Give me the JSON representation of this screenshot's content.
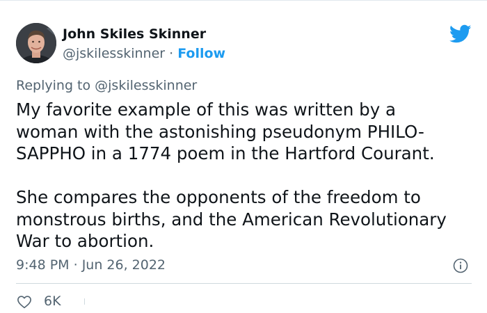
{
  "author": {
    "name": "John Skiles Skinner",
    "handle": "@jskilesskinner",
    "separator": " · ",
    "follow_label": "Follow"
  },
  "reply": {
    "prefix": "Replying to ",
    "to_handle": "@jskilesskinner"
  },
  "tweet": {
    "lines_p1": [
      "My favorite example of this was written by a",
      "woman with the astonishing pseudonym PHILO-",
      "SAPPHO in a 1774 poem in the Hartford Courant."
    ],
    "lines_p2": [
      "She compares the opponents of the freedom to",
      "monstrous births, and the American Revolutionary",
      "War to abortion."
    ]
  },
  "meta": {
    "time": "9:48 PM",
    "separator": " · ",
    "date": "Jun 26, 2022"
  },
  "actions": {
    "like_count": "6K"
  },
  "icons": {
    "brand": "twitter-bird-icon",
    "info": "info-icon",
    "like": "heart-icon"
  },
  "colors": {
    "accent": "#1d9bf0",
    "text": "#0f1419",
    "secondary": "#536471"
  }
}
